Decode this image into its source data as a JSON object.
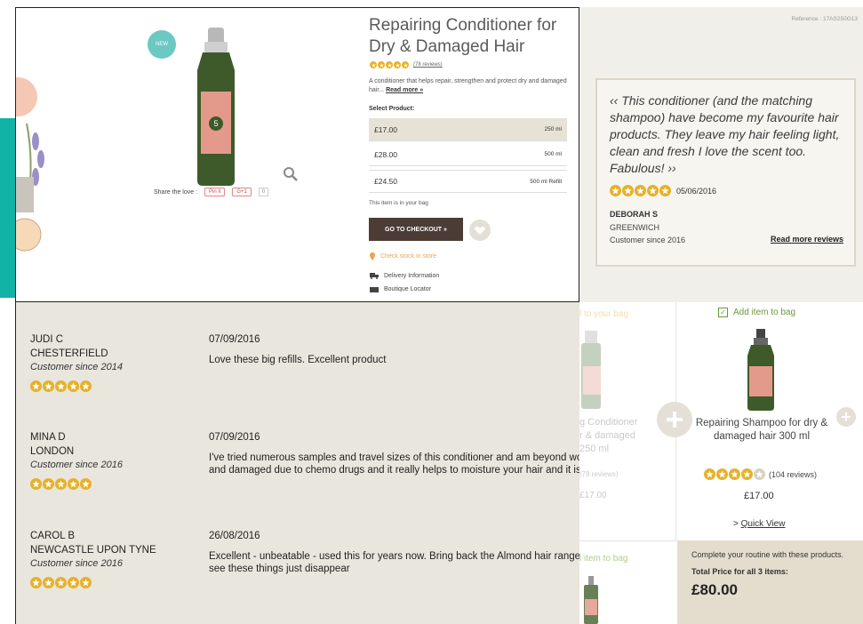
{
  "product": {
    "title": "Repairing Conditioner for Dry & Damaged Hair",
    "reviews_link": "(78 reviews)",
    "description": "A conditioner that helps repair, strengthen and protect dry and damaged hair...",
    "read_more": "Read more »",
    "select_label": "Select Product:",
    "options": [
      {
        "price": "£17.00",
        "size": "250 ml"
      },
      {
        "price": "£28.00",
        "size": "500 ml"
      },
      {
        "price": "£24.50",
        "size": "500 ml Refill"
      }
    ],
    "in_bag": "This item is in your bag",
    "checkout_label": "GO TO CHECKOUT »",
    "check_stock": "Check stock in store",
    "delivery": "Delivery Information",
    "boutique": "Boutique Locator",
    "share_label": "Share the love :",
    "share_pin": "Pin it",
    "share_g": "G+1",
    "share_count": "0",
    "badge_text": "NEW",
    "stars": 5
  },
  "quote": {
    "reference": "Reference : 17AS250G13",
    "text": "‹‹ This conditioner (and the matching shampoo) have become my favourite hair products. They leave my hair feeling light, clean and fresh I love the scent too. Fabulous! ››",
    "date": "05/06/2016",
    "name": "DEBORAH S",
    "city": "GREENWICH",
    "since": "Customer since 2016",
    "read_more": "Read more reviews",
    "stars": 5
  },
  "reviews": [
    {
      "name": "JUDI C",
      "city": "CHESTERFIELD",
      "since": "Customer since 2014",
      "date": "07/09/2016",
      "text": "Love these big refills. Excellent product",
      "stars": 5
    },
    {
      "name": "MINA D",
      "city": "LONDON",
      "since": "Customer since 2016",
      "date": "07/09/2016",
      "text": "I've tried numerous samples and travel sizes of this conditioner and am beyond wor\nand damaged due to chemo drugs and it really helps to moisture your hair and it is le",
      "stars": 5
    },
    {
      "name": "CAROL B",
      "city": "NEWCASTLE UPON TYNE",
      "since": "Customer since 2016",
      "date": "26/08/2016",
      "text": "Excellent - unbeatable - used this for years now. Bring back the Almond hair range p\nsee these things just disappear",
      "stars": 5
    }
  ],
  "bundle": {
    "faded_add": "l to your bag",
    "faded_title": "g Conditioner\nr & damaged\n250 ml",
    "faded_reviews": "(78 reviews)",
    "faded_price": "£17.00",
    "add_label": "Add item to bag",
    "item_title": "Repairing Shampoo for dry & damaged hair 300 ml",
    "item_reviews": "(104 reviews)",
    "item_price": "£17.00",
    "quick_view_prefix": "> ",
    "quick_view": "Quick View",
    "faded_add2": "l item to bag",
    "total_note": "Complete your routine with these products.",
    "total_label": "Total Price for all 3 items:",
    "total_price": "£80.00",
    "item_stars": 4
  },
  "colors": {
    "accent_teal": "#10b3a6",
    "star_gold": "#e6b12a",
    "checkout_brown": "#4b3c35",
    "stock_orange": "#e6a64a",
    "add_green": "#6a9a3a"
  }
}
